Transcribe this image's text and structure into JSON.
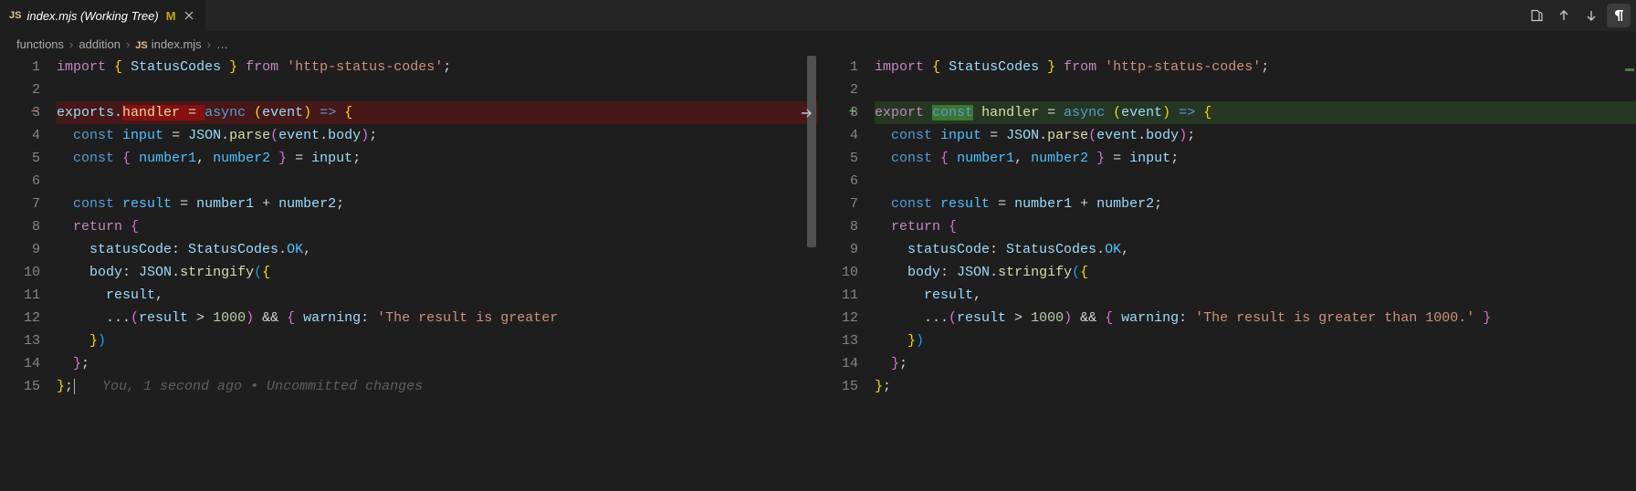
{
  "tab": {
    "icon_label": "JS",
    "title": "index.mjs (Working Tree)",
    "modified_badge": "M"
  },
  "actions": {
    "open_file": "open-file-icon",
    "prev_change": "arrow-up-icon",
    "next_change": "arrow-down-icon",
    "whitespace": "pilcrow-icon"
  },
  "breadcrumb": {
    "parts": [
      "functions",
      "addition"
    ],
    "file_icon": "JS",
    "file": "index.mjs",
    "trailing": "…"
  },
  "left": {
    "diff_kind": "removed",
    "lines": [
      {
        "n": 1,
        "tokens": [
          [
            "kw",
            "import"
          ],
          [
            "punc",
            " "
          ],
          [
            "br",
            "{"
          ],
          [
            "punc",
            " "
          ],
          [
            "var",
            "StatusCodes"
          ],
          [
            "punc",
            " "
          ],
          [
            "br",
            "}"
          ],
          [
            "punc",
            " "
          ],
          [
            "kw",
            "from"
          ],
          [
            "punc",
            " "
          ],
          [
            "str",
            "'http-status-codes'"
          ],
          [
            "punc",
            ";"
          ]
        ]
      },
      {
        "n": 2,
        "tokens": []
      },
      {
        "n": 3,
        "diff": "minus",
        "changed": true,
        "tokens": [
          [
            "var",
            "exports"
          ],
          [
            "punc",
            "."
          ],
          [
            "del_start",
            ""
          ],
          [
            "fn",
            "handler"
          ],
          [
            "punc",
            " "
          ],
          [
            "punc",
            "="
          ],
          [
            "punc",
            " "
          ],
          [
            "del_end",
            ""
          ],
          [
            "def",
            "async"
          ],
          [
            "punc",
            " "
          ],
          [
            "br",
            "("
          ],
          [
            "var",
            "event"
          ],
          [
            "br",
            ")"
          ],
          [
            "punc",
            " "
          ],
          [
            "def",
            "=>"
          ],
          [
            "punc",
            " "
          ],
          [
            "br",
            "{"
          ]
        ]
      },
      {
        "n": 4,
        "tokens": [
          [
            "punc",
            "  "
          ],
          [
            "def",
            "const"
          ],
          [
            "punc",
            " "
          ],
          [
            "const",
            "input"
          ],
          [
            "punc",
            " = "
          ],
          [
            "var",
            "JSON"
          ],
          [
            "punc",
            "."
          ],
          [
            "fn",
            "parse"
          ],
          [
            "br2",
            "("
          ],
          [
            "var",
            "event"
          ],
          [
            "punc",
            "."
          ],
          [
            "var",
            "body"
          ],
          [
            "br2",
            ")"
          ],
          [
            "punc",
            ";"
          ]
        ]
      },
      {
        "n": 5,
        "tokens": [
          [
            "punc",
            "  "
          ],
          [
            "def",
            "const"
          ],
          [
            "punc",
            " "
          ],
          [
            "br2",
            "{"
          ],
          [
            "punc",
            " "
          ],
          [
            "const",
            "number1"
          ],
          [
            "punc",
            ", "
          ],
          [
            "const",
            "number2"
          ],
          [
            "punc",
            " "
          ],
          [
            "br2",
            "}"
          ],
          [
            "punc",
            " = "
          ],
          [
            "var",
            "input"
          ],
          [
            "punc",
            ";"
          ]
        ]
      },
      {
        "n": 6,
        "tokens": []
      },
      {
        "n": 7,
        "tokens": [
          [
            "punc",
            "  "
          ],
          [
            "def",
            "const"
          ],
          [
            "punc",
            " "
          ],
          [
            "const",
            "result"
          ],
          [
            "punc",
            " = "
          ],
          [
            "var",
            "number1"
          ],
          [
            "punc",
            " + "
          ],
          [
            "var",
            "number2"
          ],
          [
            "punc",
            ";"
          ]
        ]
      },
      {
        "n": 8,
        "tokens": [
          [
            "punc",
            "  "
          ],
          [
            "kw",
            "return"
          ],
          [
            "punc",
            " "
          ],
          [
            "br2",
            "{"
          ]
        ]
      },
      {
        "n": 9,
        "tokens": [
          [
            "punc",
            "    "
          ],
          [
            "prop",
            "statusCode"
          ],
          [
            "punc",
            ": "
          ],
          [
            "var",
            "StatusCodes"
          ],
          [
            "punc",
            "."
          ],
          [
            "const",
            "OK"
          ],
          [
            "punc",
            ","
          ]
        ]
      },
      {
        "n": 10,
        "tokens": [
          [
            "punc",
            "    "
          ],
          [
            "prop",
            "body"
          ],
          [
            "punc",
            ": "
          ],
          [
            "var",
            "JSON"
          ],
          [
            "punc",
            "."
          ],
          [
            "fn",
            "stringify"
          ],
          [
            "br3",
            "("
          ],
          [
            "br",
            "{"
          ]
        ]
      },
      {
        "n": 11,
        "tokens": [
          [
            "punc",
            "      "
          ],
          [
            "var",
            "result"
          ],
          [
            "punc",
            ","
          ]
        ]
      },
      {
        "n": 12,
        "tokens": [
          [
            "punc",
            "      ..."
          ],
          [
            "br2",
            "("
          ],
          [
            "var",
            "result"
          ],
          [
            "punc",
            " > "
          ],
          [
            "num",
            "1000"
          ],
          [
            "br2",
            ")"
          ],
          [
            "punc",
            " && "
          ],
          [
            "br2",
            "{"
          ],
          [
            "punc",
            " "
          ],
          [
            "prop",
            "warning"
          ],
          [
            "punc",
            ": "
          ],
          [
            "str",
            "'The result is greater"
          ]
        ]
      },
      {
        "n": 13,
        "tokens": [
          [
            "punc",
            "    "
          ],
          [
            "br",
            "}"
          ],
          [
            "br3",
            ")"
          ]
        ]
      },
      {
        "n": 14,
        "tokens": [
          [
            "punc",
            "  "
          ],
          [
            "br2",
            "}"
          ],
          [
            "punc",
            ";"
          ]
        ]
      },
      {
        "n": 15,
        "tokens": [
          [
            "br",
            "}"
          ],
          [
            "punc",
            ";"
          ]
        ],
        "blame": "You, 1 second ago • Uncommitted changes",
        "cursor": true
      }
    ]
  },
  "right": {
    "diff_kind": "added",
    "lines": [
      {
        "n": 1,
        "tokens": [
          [
            "kw",
            "import"
          ],
          [
            "punc",
            " "
          ],
          [
            "br",
            "{"
          ],
          [
            "punc",
            " "
          ],
          [
            "var",
            "StatusCodes"
          ],
          [
            "punc",
            " "
          ],
          [
            "br",
            "}"
          ],
          [
            "punc",
            " "
          ],
          [
            "kw",
            "from"
          ],
          [
            "punc",
            " "
          ],
          [
            "str",
            "'http-status-codes'"
          ],
          [
            "punc",
            ";"
          ]
        ]
      },
      {
        "n": 2,
        "tokens": []
      },
      {
        "n": 3,
        "diff": "plus",
        "changed": true,
        "tokens": [
          [
            "kw",
            "export"
          ],
          [
            "punc",
            " "
          ],
          [
            "add_start",
            ""
          ],
          [
            "def",
            "const"
          ],
          [
            "add_end",
            ""
          ],
          [
            "punc",
            " "
          ],
          [
            "fn",
            "handler"
          ],
          [
            "punc",
            " = "
          ],
          [
            "def",
            "async"
          ],
          [
            "punc",
            " "
          ],
          [
            "br",
            "("
          ],
          [
            "var",
            "event"
          ],
          [
            "br",
            ")"
          ],
          [
            "punc",
            " "
          ],
          [
            "def",
            "=>"
          ],
          [
            "punc",
            " "
          ],
          [
            "br",
            "{"
          ]
        ]
      },
      {
        "n": 4,
        "tokens": [
          [
            "punc",
            "  "
          ],
          [
            "def",
            "const"
          ],
          [
            "punc",
            " "
          ],
          [
            "const",
            "input"
          ],
          [
            "punc",
            " = "
          ],
          [
            "var",
            "JSON"
          ],
          [
            "punc",
            "."
          ],
          [
            "fn",
            "parse"
          ],
          [
            "br2",
            "("
          ],
          [
            "var",
            "event"
          ],
          [
            "punc",
            "."
          ],
          [
            "var",
            "body"
          ],
          [
            "br2",
            ")"
          ],
          [
            "punc",
            ";"
          ]
        ]
      },
      {
        "n": 5,
        "tokens": [
          [
            "punc",
            "  "
          ],
          [
            "def",
            "const"
          ],
          [
            "punc",
            " "
          ],
          [
            "br2",
            "{"
          ],
          [
            "punc",
            " "
          ],
          [
            "const",
            "number1"
          ],
          [
            "punc",
            ", "
          ],
          [
            "const",
            "number2"
          ],
          [
            "punc",
            " "
          ],
          [
            "br2",
            "}"
          ],
          [
            "punc",
            " = "
          ],
          [
            "var",
            "input"
          ],
          [
            "punc",
            ";"
          ]
        ]
      },
      {
        "n": 6,
        "tokens": []
      },
      {
        "n": 7,
        "tokens": [
          [
            "punc",
            "  "
          ],
          [
            "def",
            "const"
          ],
          [
            "punc",
            " "
          ],
          [
            "const",
            "result"
          ],
          [
            "punc",
            " = "
          ],
          [
            "var",
            "number1"
          ],
          [
            "punc",
            " + "
          ],
          [
            "var",
            "number2"
          ],
          [
            "punc",
            ";"
          ]
        ]
      },
      {
        "n": 8,
        "tokens": [
          [
            "punc",
            "  "
          ],
          [
            "kw",
            "return"
          ],
          [
            "punc",
            " "
          ],
          [
            "br2",
            "{"
          ]
        ]
      },
      {
        "n": 9,
        "tokens": [
          [
            "punc",
            "    "
          ],
          [
            "prop",
            "statusCode"
          ],
          [
            "punc",
            ": "
          ],
          [
            "var",
            "StatusCodes"
          ],
          [
            "punc",
            "."
          ],
          [
            "const",
            "OK"
          ],
          [
            "punc",
            ","
          ]
        ]
      },
      {
        "n": 10,
        "tokens": [
          [
            "punc",
            "    "
          ],
          [
            "prop",
            "body"
          ],
          [
            "punc",
            ": "
          ],
          [
            "var",
            "JSON"
          ],
          [
            "punc",
            "."
          ],
          [
            "fn",
            "stringify"
          ],
          [
            "br3",
            "("
          ],
          [
            "br",
            "{"
          ]
        ]
      },
      {
        "n": 11,
        "tokens": [
          [
            "punc",
            "      "
          ],
          [
            "var",
            "result"
          ],
          [
            "punc",
            ","
          ]
        ]
      },
      {
        "n": 12,
        "tokens": [
          [
            "punc",
            "      ..."
          ],
          [
            "br2",
            "("
          ],
          [
            "var",
            "result"
          ],
          [
            "punc",
            " > "
          ],
          [
            "num",
            "1000"
          ],
          [
            "br2",
            ")"
          ],
          [
            "punc",
            " && "
          ],
          [
            "br2",
            "{"
          ],
          [
            "punc",
            " "
          ],
          [
            "prop",
            "warning"
          ],
          [
            "punc",
            ": "
          ],
          [
            "str",
            "'The result is greater than 1000.'"
          ],
          [
            "punc",
            " "
          ],
          [
            "br2",
            "}"
          ]
        ]
      },
      {
        "n": 13,
        "tokens": [
          [
            "punc",
            "    "
          ],
          [
            "br",
            "}"
          ],
          [
            "br3",
            ")"
          ]
        ]
      },
      {
        "n": 14,
        "tokens": [
          [
            "punc",
            "  "
          ],
          [
            "br2",
            "}"
          ],
          [
            "punc",
            ";"
          ]
        ]
      },
      {
        "n": 15,
        "tokens": [
          [
            "br",
            "}"
          ],
          [
            "punc",
            ";"
          ]
        ]
      }
    ]
  },
  "center_arrow_line_index": 2
}
